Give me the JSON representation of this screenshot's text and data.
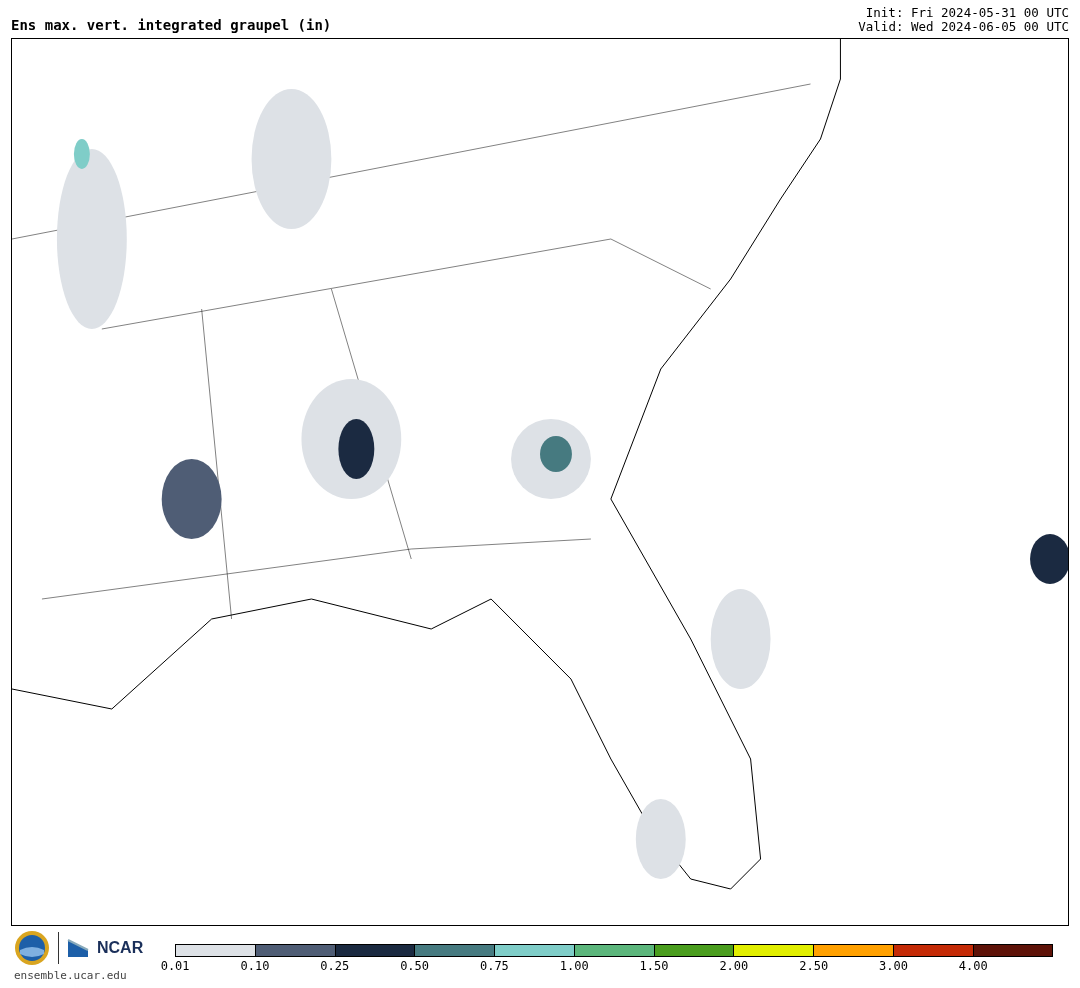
{
  "header": {
    "title": "Ens max. vert. integrated graupel (in)",
    "init": "Init: Fri 2024-05-31 00 UTC",
    "valid": "Valid: Wed 2024-06-05 00 UTC"
  },
  "footer": {
    "org": "NCAR",
    "site": "ensemble.ucar.edu"
  },
  "colorbar": {
    "bins": [
      {
        "label": "0.01",
        "color": "#dde1e6"
      },
      {
        "label": "0.10",
        "color": "#4f5d75"
      },
      {
        "label": "0.25",
        "color": "#1b2a41"
      },
      {
        "label": "0.50",
        "color": "#467a80"
      },
      {
        "label": "0.75",
        "color": "#7fcdc8"
      },
      {
        "label": "1.00",
        "color": "#5cb67c"
      },
      {
        "label": "1.50",
        "color": "#4a9d1e"
      },
      {
        "label": "2.00",
        "color": "#e1ee00"
      },
      {
        "label": "2.50",
        "color": "#ffa000"
      },
      {
        "label": "3.00",
        "color": "#c42a06"
      },
      {
        "label": "4.00",
        "color": "#5e1208"
      }
    ]
  }
}
